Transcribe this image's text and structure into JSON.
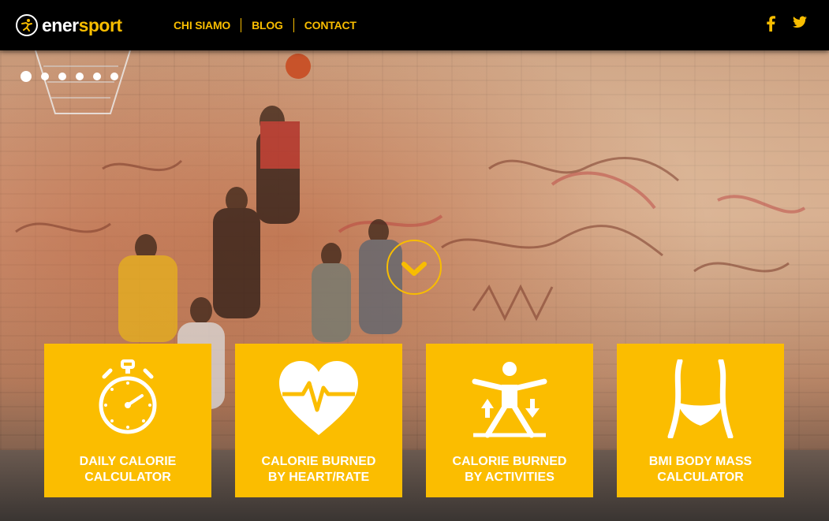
{
  "brand": {
    "name_part1": "ener",
    "name_part2": "sport",
    "accent_color": "#f8bd00"
  },
  "nav": {
    "items": [
      {
        "label": "CHI SIAMO"
      },
      {
        "label": "BLOG"
      },
      {
        "label": "CONTACT"
      }
    ]
  },
  "social": {
    "icons": [
      "facebook-icon",
      "twitter-icon"
    ]
  },
  "hero": {
    "slider_dots": 6,
    "active_slide": 1,
    "scroll_icon": "chevron-down-icon"
  },
  "cards": [
    {
      "icon": "stopwatch-icon",
      "label": "DAILY CALORIE\nCALCULATOR"
    },
    {
      "icon": "heart-rate-icon",
      "label": "CALORIE BURNED\nBY HEART/RATE"
    },
    {
      "icon": "activity-figure-icon",
      "label": "CALORIE BURNED\nBY ACTIVITIES"
    },
    {
      "icon": "waist-icon",
      "label": "BMI BODY MASS\nCALCULATOR"
    }
  ]
}
